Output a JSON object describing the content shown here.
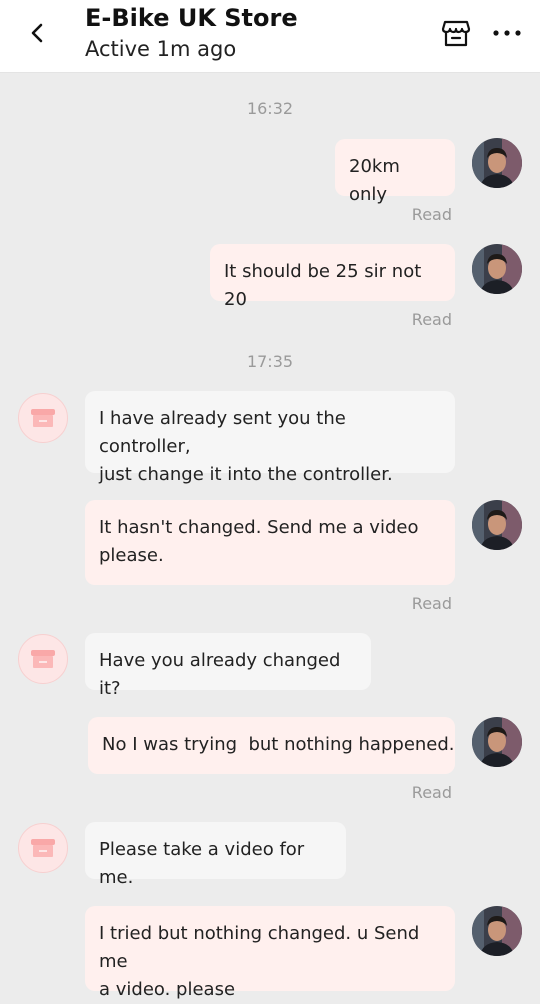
{
  "header": {
    "title": "E-Bike UK Store",
    "status": "Active 1m ago",
    "icons": {
      "back": "chevron-left-icon",
      "store": "store-icon",
      "more": "more-horizontal-icon"
    }
  },
  "colors": {
    "my_bubble": "#fff0ee",
    "their_bubble": "#f6f6f6",
    "background": "#ececec"
  },
  "messages": {
    "ts1": "16:32",
    "m1": {
      "text": "20km only",
      "status": "Read"
    },
    "m2": {
      "text": "It should be 25 sir not 20",
      "status": "Read"
    },
    "ts2": "17:35",
    "m3": {
      "line1": "I have already sent you the controller,",
      "line2": "just change it into the controller."
    },
    "m4": {
      "line1": "It hasn't changed. Send me a video",
      "line2": "please.",
      "status": "Read"
    },
    "m5": {
      "text": "Have you already changed it?"
    },
    "m6": {
      "text": "No I was trying  but nothing happened.",
      "status": "Read"
    },
    "m7": {
      "text": "Please take a video for me."
    },
    "m8": {
      "line1": "I tried but nothing changed. u Send me",
      "line2": "a video. please"
    }
  }
}
